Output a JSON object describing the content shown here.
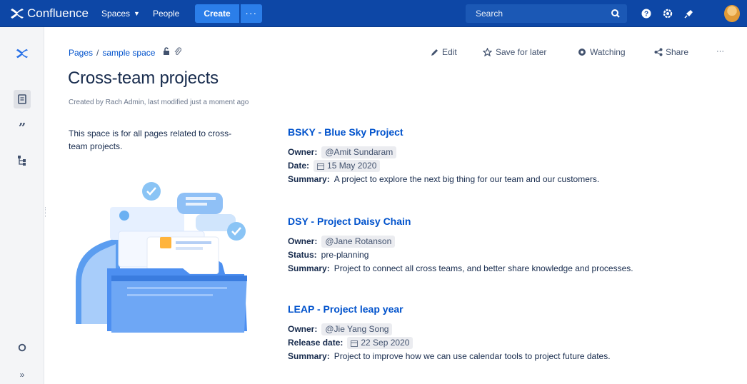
{
  "topnav": {
    "brand": "Confluence",
    "spaces": "Spaces",
    "people": "People",
    "create": "Create",
    "more": "···",
    "search_placeholder": "Search",
    "icons": [
      "search-icon",
      "help-icon",
      "settings-icon",
      "notifications-icon",
      "avatar"
    ]
  },
  "sidebar": {
    "icons": [
      "confluence-logo-icon",
      "pages-icon",
      "quote-icon",
      "hierarchy-icon",
      "settings-icon",
      "expand-icon"
    ]
  },
  "breadcrumb": {
    "items": [
      "Pages",
      "sample space"
    ],
    "separator": "/"
  },
  "actions": {
    "edit": "Edit",
    "save_for_later": "Save for later",
    "watching": "Watching",
    "share": "Share",
    "more": "···"
  },
  "page": {
    "title": "Cross-team projects",
    "byline": "Created by Rach Admin, last modified just a moment ago",
    "intro": "This space is for all pages related to cross-team projects."
  },
  "projects": [
    {
      "title": "BSKY - Blue Sky Project",
      "rows": [
        {
          "label": "Owner:",
          "value": "@Amit Sundaram",
          "kind": "mention"
        },
        {
          "label": "Date:",
          "value": "15 May 2020",
          "kind": "date"
        },
        {
          "label": "Summary:",
          "value": "A project to explore the next big thing for our team and our customers.",
          "kind": "text"
        }
      ]
    },
    {
      "title": "DSY - Project Daisy Chain",
      "rows": [
        {
          "label": "Owner:",
          "value": "@Jane Rotanson",
          "kind": "mention"
        },
        {
          "label": "Status:",
          "value": "pre-planning",
          "kind": "text"
        },
        {
          "label": "Summary:",
          "value": "Project to connect all cross teams, and better share knowledge and processes.",
          "kind": "text"
        }
      ]
    },
    {
      "title": "LEAP - Project leap year",
      "rows": [
        {
          "label": "Owner:",
          "value": "@Jie Yang Song",
          "kind": "mention"
        },
        {
          "label": "Release date:",
          "value": "22 Sep 2020",
          "kind": "date"
        },
        {
          "label": "Summary:",
          "value": "Project to improve how we can use calendar tools to project future dates.",
          "kind": "text"
        }
      ]
    }
  ],
  "colors": {
    "nav_bg": "#0d47a6",
    "create_bg": "#2b7ee9",
    "link": "#0052cc",
    "text": "#172b4d"
  }
}
